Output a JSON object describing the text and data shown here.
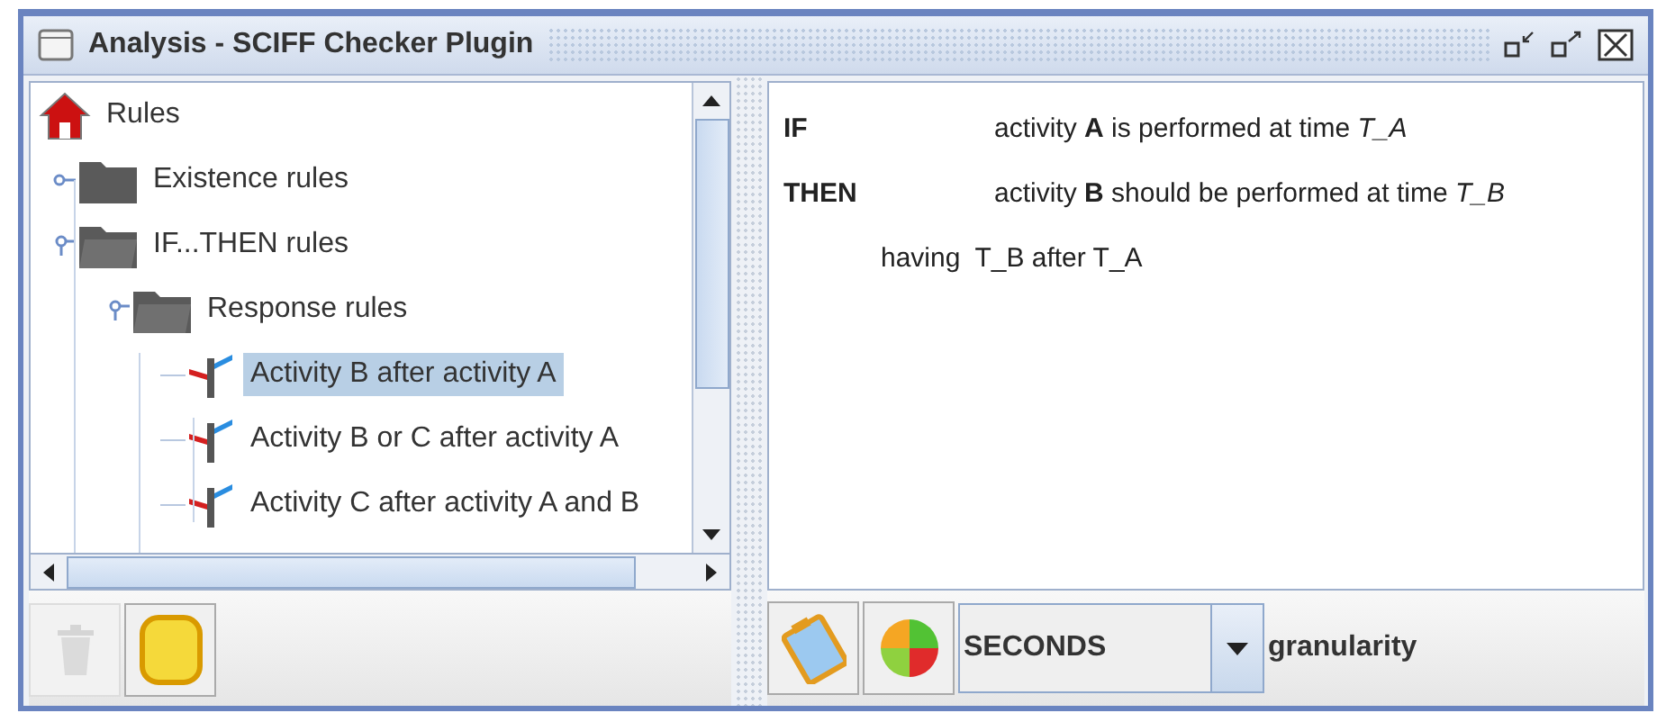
{
  "window": {
    "title": "Analysis - SCIFF Checker Plugin"
  },
  "tree": [
    {
      "label": "Rules",
      "kind": "root",
      "selected": false,
      "children": [
        {
          "label": "Existence rules",
          "kind": "folder",
          "expanded": false,
          "selected": false
        },
        {
          "label": "IF...THEN rules",
          "kind": "folder",
          "expanded": true,
          "selected": false,
          "children": [
            {
              "label": "Response rules",
              "kind": "folder",
              "expanded": true,
              "selected": false,
              "children": [
                {
                  "label": "Activity B after activity A",
                  "kind": "rule",
                  "selected": true
                },
                {
                  "label": "Activity B or C after activity A",
                  "kind": "rule",
                  "selected": false
                },
                {
                  "label": "Activity C after activity A and B",
                  "kind": "rule",
                  "selected": false
                }
              ]
            }
          ]
        }
      ]
    }
  ],
  "left_toolbar": [
    {
      "kind": "trash",
      "disabled": true
    },
    {
      "kind": "note",
      "disabled": false
    }
  ],
  "rule": [
    {
      "keyword": "IF",
      "text": "activity **A** is performed at time *T_A*"
    },
    {
      "keyword": "THEN",
      "text": "activity **B** should be performed at time *T_B*"
    }
  ],
  "having": {
    "label": "having",
    "text": "T_B after T_A"
  },
  "right_toolbar": [
    {
      "kind": "clipboard"
    },
    {
      "kind": "pie"
    }
  ],
  "granularity": {
    "value": "SECONDS",
    "label": "granularity"
  }
}
